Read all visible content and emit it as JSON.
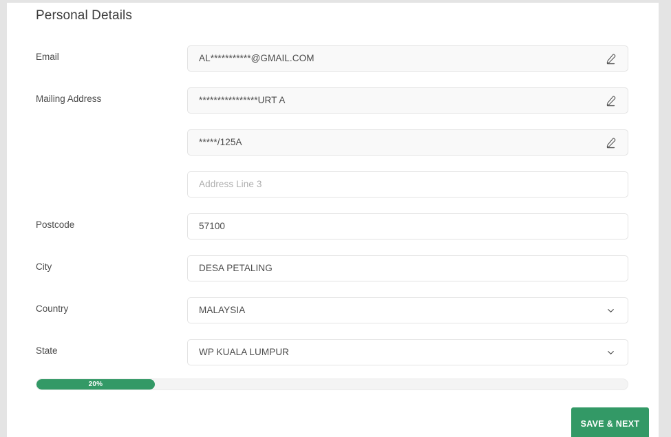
{
  "page": {
    "title": "Personal Details"
  },
  "theme": {
    "accent": "#339966",
    "page_background": "#e4e4e4",
    "card_background": "#ffffff",
    "readonly_field_background": "#f9f9f9",
    "field_border": "#e3e3e3",
    "label_color": "#4a4a4a",
    "placeholder_color": "#aeaeae"
  },
  "fields": [
    {
      "label": "Email",
      "value": "AL***********@GMAIL.COM",
      "placeholder": "",
      "type": "masked-text",
      "readonly": true,
      "icon": "pencil-edit-icon"
    },
    {
      "label": "Mailing Address",
      "value": "****************URT A",
      "placeholder": "",
      "type": "masked-text",
      "readonly": true,
      "icon": "pencil-edit-icon"
    },
    {
      "label": "",
      "value": "*****/125A",
      "placeholder": "",
      "type": "masked-text",
      "readonly": true,
      "icon": "pencil-edit-icon"
    },
    {
      "label": "",
      "value": "",
      "placeholder": "Address Line 3",
      "type": "text",
      "readonly": false,
      "icon": ""
    },
    {
      "label": "Postcode",
      "value": "57100",
      "placeholder": "",
      "type": "text",
      "readonly": false,
      "icon": ""
    },
    {
      "label": "City",
      "value": "DESA PETALING",
      "placeholder": "",
      "type": "text",
      "readonly": false,
      "icon": ""
    },
    {
      "label": "Country",
      "value": "MALAYSIA",
      "placeholder": "",
      "type": "select",
      "readonly": false,
      "icon": "chevron-down-icon"
    },
    {
      "label": "State",
      "value": "WP KUALA LUMPUR",
      "placeholder": "",
      "type": "select",
      "readonly": false,
      "icon": "chevron-down-icon"
    }
  ],
  "progress": {
    "label": "20%",
    "percent": 20
  },
  "footer": {
    "save_label": "SAVE & NEXT"
  }
}
